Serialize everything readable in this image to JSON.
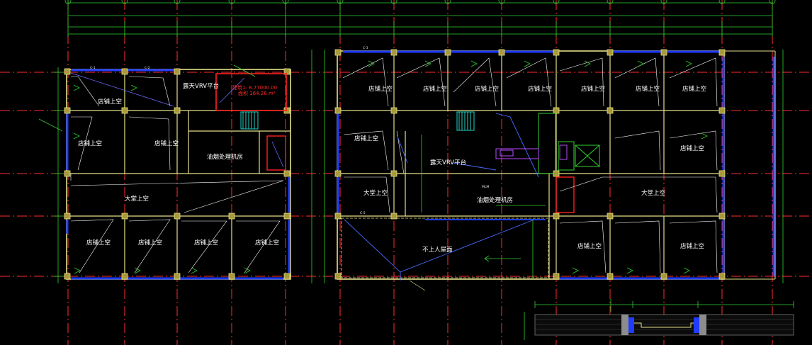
{
  "drawing": {
    "colors": {
      "background": "#000000",
      "wall": "#e5e08a",
      "glazing": "#1f3cff",
      "axis": "#ff2d2d",
      "grid_marker": "#2fd12f",
      "dimension": "#2fd12f",
      "text": "#ffffff",
      "annotation": "#ff3030",
      "stair": "#22d3c5"
    },
    "annotations": {
      "vrv_platform": "露天VRV平台",
      "red_label_1": "建筑1: 8.77000.00",
      "red_label_2": "面积 164.26 m²"
    },
    "left_block": {
      "rooms": [
        {
          "id": "l-r1",
          "label": "店铺上空"
        },
        {
          "id": "l-r2",
          "label": "露天VRV平台"
        },
        {
          "id": "l-r3",
          "label": "店铺上空"
        },
        {
          "id": "l-r4",
          "label": "店铺上空"
        },
        {
          "id": "l-r5",
          "label": "油烟处理机房"
        },
        {
          "id": "l-r6",
          "label": "大堂上空"
        },
        {
          "id": "l-r7",
          "label": "店铺上空"
        },
        {
          "id": "l-r8",
          "label": "店铺上空"
        },
        {
          "id": "l-r9",
          "label": "店铺上空"
        },
        {
          "id": "l-r10",
          "label": "店铺上空"
        }
      ]
    },
    "right_block": {
      "rooms": [
        {
          "id": "r-r1",
          "label": "店铺上空"
        },
        {
          "id": "r-r2",
          "label": "店铺上空"
        },
        {
          "id": "r-r3",
          "label": "店铺上空"
        },
        {
          "id": "r-r4",
          "label": "店铺上空"
        },
        {
          "id": "r-r5",
          "label": "店铺上空"
        },
        {
          "id": "r-r6",
          "label": "店铺上空"
        },
        {
          "id": "r-r7",
          "label": "店铺上空"
        },
        {
          "id": "r-r8",
          "label": "露天VRV平台"
        },
        {
          "id": "r-r9",
          "label": "店铺上空"
        },
        {
          "id": "r-r10",
          "label": "店铺上空"
        },
        {
          "id": "r-r11",
          "label": "大堂上空"
        },
        {
          "id": "r-r12",
          "label": "油烟处理机房"
        },
        {
          "id": "r-r13",
          "label": "大堂上空"
        },
        {
          "id": "r-r14",
          "label": "不上人屋面"
        },
        {
          "id": "r-r15",
          "label": "店铺上空"
        },
        {
          "id": "r-r16",
          "label": "店铺上空"
        }
      ]
    },
    "small_labels": [
      "C-1",
      "C-2",
      "C-3",
      "MLM",
      "C-5"
    ]
  }
}
